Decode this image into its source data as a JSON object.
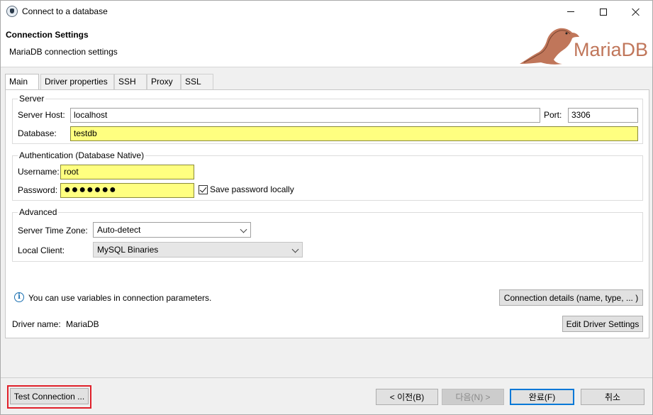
{
  "window": {
    "title": "Connect to a database"
  },
  "header": {
    "title": "Connection Settings",
    "subtitle": "MariaDB connection settings",
    "logo_text": "MariaDB"
  },
  "tabs": [
    {
      "label": "Main",
      "active": true
    },
    {
      "label": "Driver properties",
      "active": false
    },
    {
      "label": "SSH",
      "active": false
    },
    {
      "label": "Proxy",
      "active": false
    },
    {
      "label": "SSL",
      "active": false
    }
  ],
  "server": {
    "group_label": "Server",
    "host_label": "Server Host:",
    "host_value": "localhost",
    "port_label": "Port:",
    "port_value": "3306",
    "database_label": "Database:",
    "database_value": "testdb"
  },
  "auth": {
    "group_label": "Authentication (Database Native)",
    "username_label": "Username:",
    "username_value": "root",
    "password_label": "Password:",
    "password_mask": "●●●●●●●",
    "save_password_label": "Save password locally",
    "save_password_checked": true
  },
  "advanced": {
    "group_label": "Advanced",
    "timezone_label": "Server Time Zone:",
    "timezone_value": "Auto-detect",
    "local_client_label": "Local Client:",
    "local_client_value": "MySQL Binaries"
  },
  "info": {
    "variables_text": "You can use variables in connection parameters.",
    "connection_details_button": "Connection details (name, type, ... )"
  },
  "driver": {
    "label": "Driver name:",
    "value": "MariaDB",
    "edit_button": "Edit Driver Settings"
  },
  "footer": {
    "test_connection": "Test Connection ...",
    "prev": "< 이전(B)",
    "next": "다음(N) >",
    "finish": "완료(F)",
    "cancel": "취소"
  },
  "colors": {
    "required_field": "#ffff80",
    "highlight_border": "#e0202a",
    "logo_blue": "#003545",
    "logo_brown": "#c0765a"
  }
}
